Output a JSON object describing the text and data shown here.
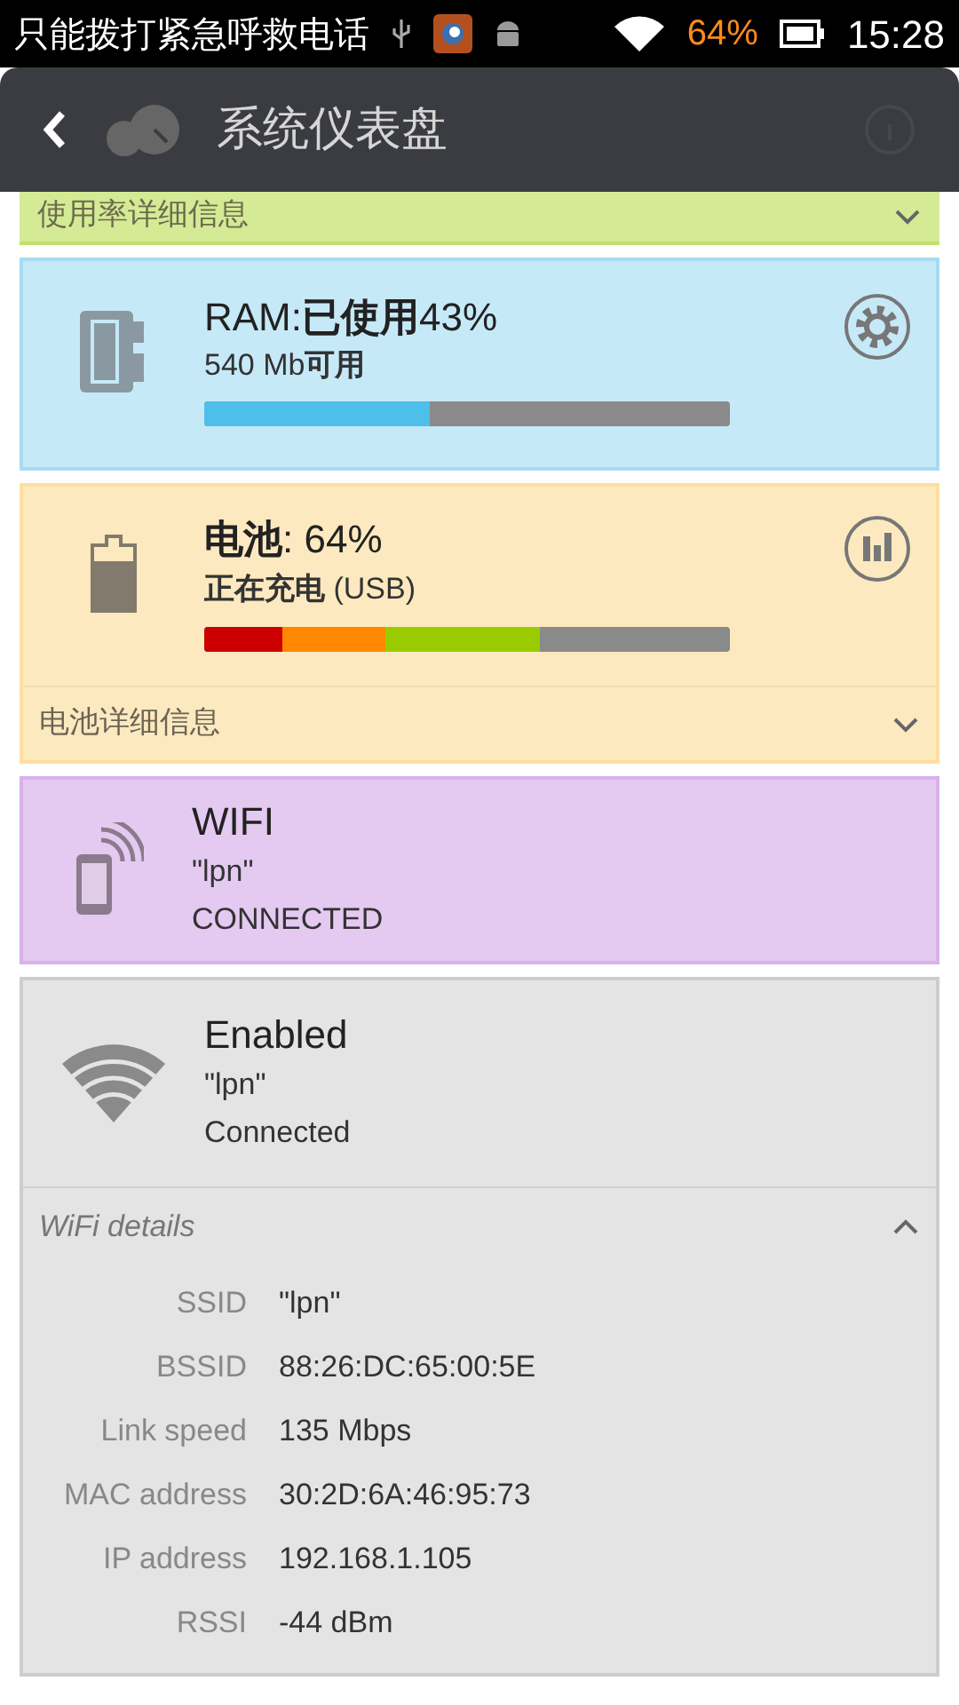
{
  "status_bar": {
    "carrier": "只能拨打紧急呼救电话",
    "battery_percent": "64%",
    "time": "15:28"
  },
  "header": {
    "title": "系统仪表盘"
  },
  "usage_details": {
    "label": "使用率详细信息",
    "expanded": false
  },
  "ram": {
    "label": "RAM:",
    "used_label": "已使用",
    "percent": "43%",
    "free_amount": "540 Mb",
    "free_label": "可用",
    "level": 0.43
  },
  "battery": {
    "label": "电池",
    "percent": ": 64%",
    "state": "正在充电",
    "source": " (USB)",
    "level": 0.64,
    "details_label": "电池详细信息",
    "details_expanded": false
  },
  "wifi": {
    "title": "WIFI",
    "ssid": "\"lpn\"",
    "status": "CONNECTED"
  },
  "wifi_card": {
    "title": "Enabled",
    "ssid": "\"lpn\"",
    "status": "Connected",
    "details_label": "WiFi details",
    "details_expanded": true,
    "details": [
      {
        "label": "SSID",
        "value": "\"lpn\""
      },
      {
        "label": "BSSID",
        "value": "88:26:DC:65:00:5E"
      },
      {
        "label": "Link speed",
        "value": "135 Mbps"
      },
      {
        "label": "MAC address",
        "value": "30:2D:6A:46:95:73"
      },
      {
        "label": "IP address",
        "value": "192.168.1.105"
      },
      {
        "label": "RSSI",
        "value": "-44 dBm"
      }
    ]
  }
}
